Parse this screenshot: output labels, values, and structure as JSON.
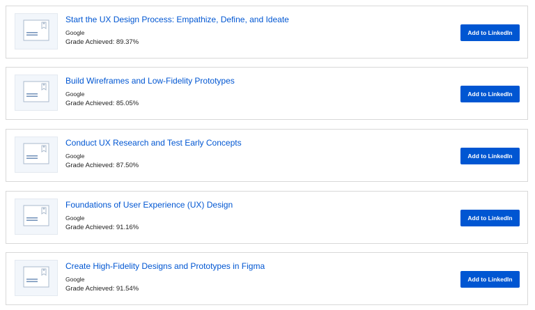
{
  "certificates": [
    {
      "title": "Start the UX Design Process: Empathize, Define, and Ideate",
      "partner": "Google",
      "grade": "Grade Achieved: 89.37%",
      "button_label": "Add to LinkedIn",
      "thumbnail_icon": "certificate-icon"
    },
    {
      "title": "Build Wireframes and Low-Fidelity Prototypes",
      "partner": "Google",
      "grade": "Grade Achieved: 85.05%",
      "button_label": "Add to LinkedIn",
      "thumbnail_icon": "certificate-icon"
    },
    {
      "title": "Conduct UX Research and Test Early Concepts",
      "partner": "Google",
      "grade": "Grade Achieved: 87.50%",
      "button_label": "Add to LinkedIn",
      "thumbnail_icon": "certificate-icon"
    },
    {
      "title": "Foundations of User Experience (UX) Design",
      "partner": "Google",
      "grade": "Grade Achieved: 91.16%",
      "button_label": "Add to LinkedIn",
      "thumbnail_icon": "certificate-icon"
    },
    {
      "title": "Create High-Fidelity Designs and Prototypes in Figma",
      "partner": "Google",
      "grade": "Grade Achieved: 91.54%",
      "button_label": "Add to LinkedIn",
      "thumbnail_icon": "certificate-icon"
    }
  ],
  "colors": {
    "link": "#0056d2",
    "button_bg": "#0056d2",
    "card_border": "#d8d8d8",
    "thumb_bg": "#f2f6fb"
  }
}
